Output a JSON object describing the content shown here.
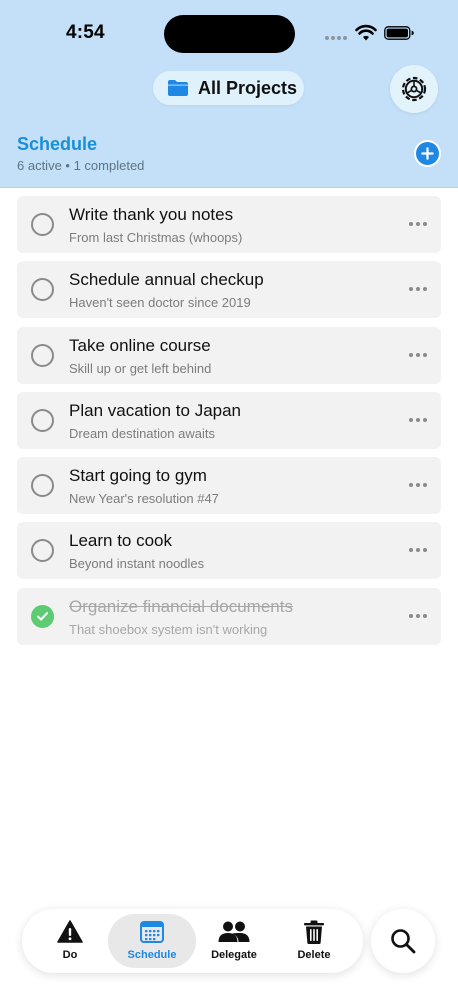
{
  "status_bar": {
    "time": "4:54"
  },
  "header": {
    "project_selector": {
      "label": "All Projects",
      "icon": "folder-icon"
    },
    "settings_icon": "gear-icon",
    "section_title": "Schedule",
    "section_subtitle": "6 active • 1 completed",
    "add_icon": "plus-icon"
  },
  "tasks": [
    {
      "title": "Write thank you notes",
      "subtitle": "From last Christmas (whoops)",
      "completed": false
    },
    {
      "title": "Schedule annual checkup",
      "subtitle": "Haven't seen doctor since 2019",
      "completed": false
    },
    {
      "title": "Take online course",
      "subtitle": "Skill up or get left behind",
      "completed": false
    },
    {
      "title": "Plan vacation to Japan",
      "subtitle": "Dream destination awaits",
      "completed": false
    },
    {
      "title": "Start going to gym",
      "subtitle": "New Year's resolution #47",
      "completed": false
    },
    {
      "title": "Learn to cook",
      "subtitle": "Beyond instant noodles",
      "completed": false
    },
    {
      "title": "Organize financial documents",
      "subtitle": "That shoebox system isn't working",
      "completed": true
    }
  ],
  "tab_bar": {
    "tabs": [
      {
        "label": "Do",
        "icon": "warning-icon",
        "active": false
      },
      {
        "label": "Schedule",
        "icon": "calendar-icon",
        "active": true
      },
      {
        "label": "Delegate",
        "icon": "people-icon",
        "active": false
      },
      {
        "label": "Delete",
        "icon": "trash-icon",
        "active": false
      }
    ],
    "search_icon": "search-icon"
  },
  "colors": {
    "header_bg": "#c3e0f8",
    "accent": "#1e88e5",
    "section_title": "#1a8fd6",
    "completed_check": "#5ccb71"
  }
}
